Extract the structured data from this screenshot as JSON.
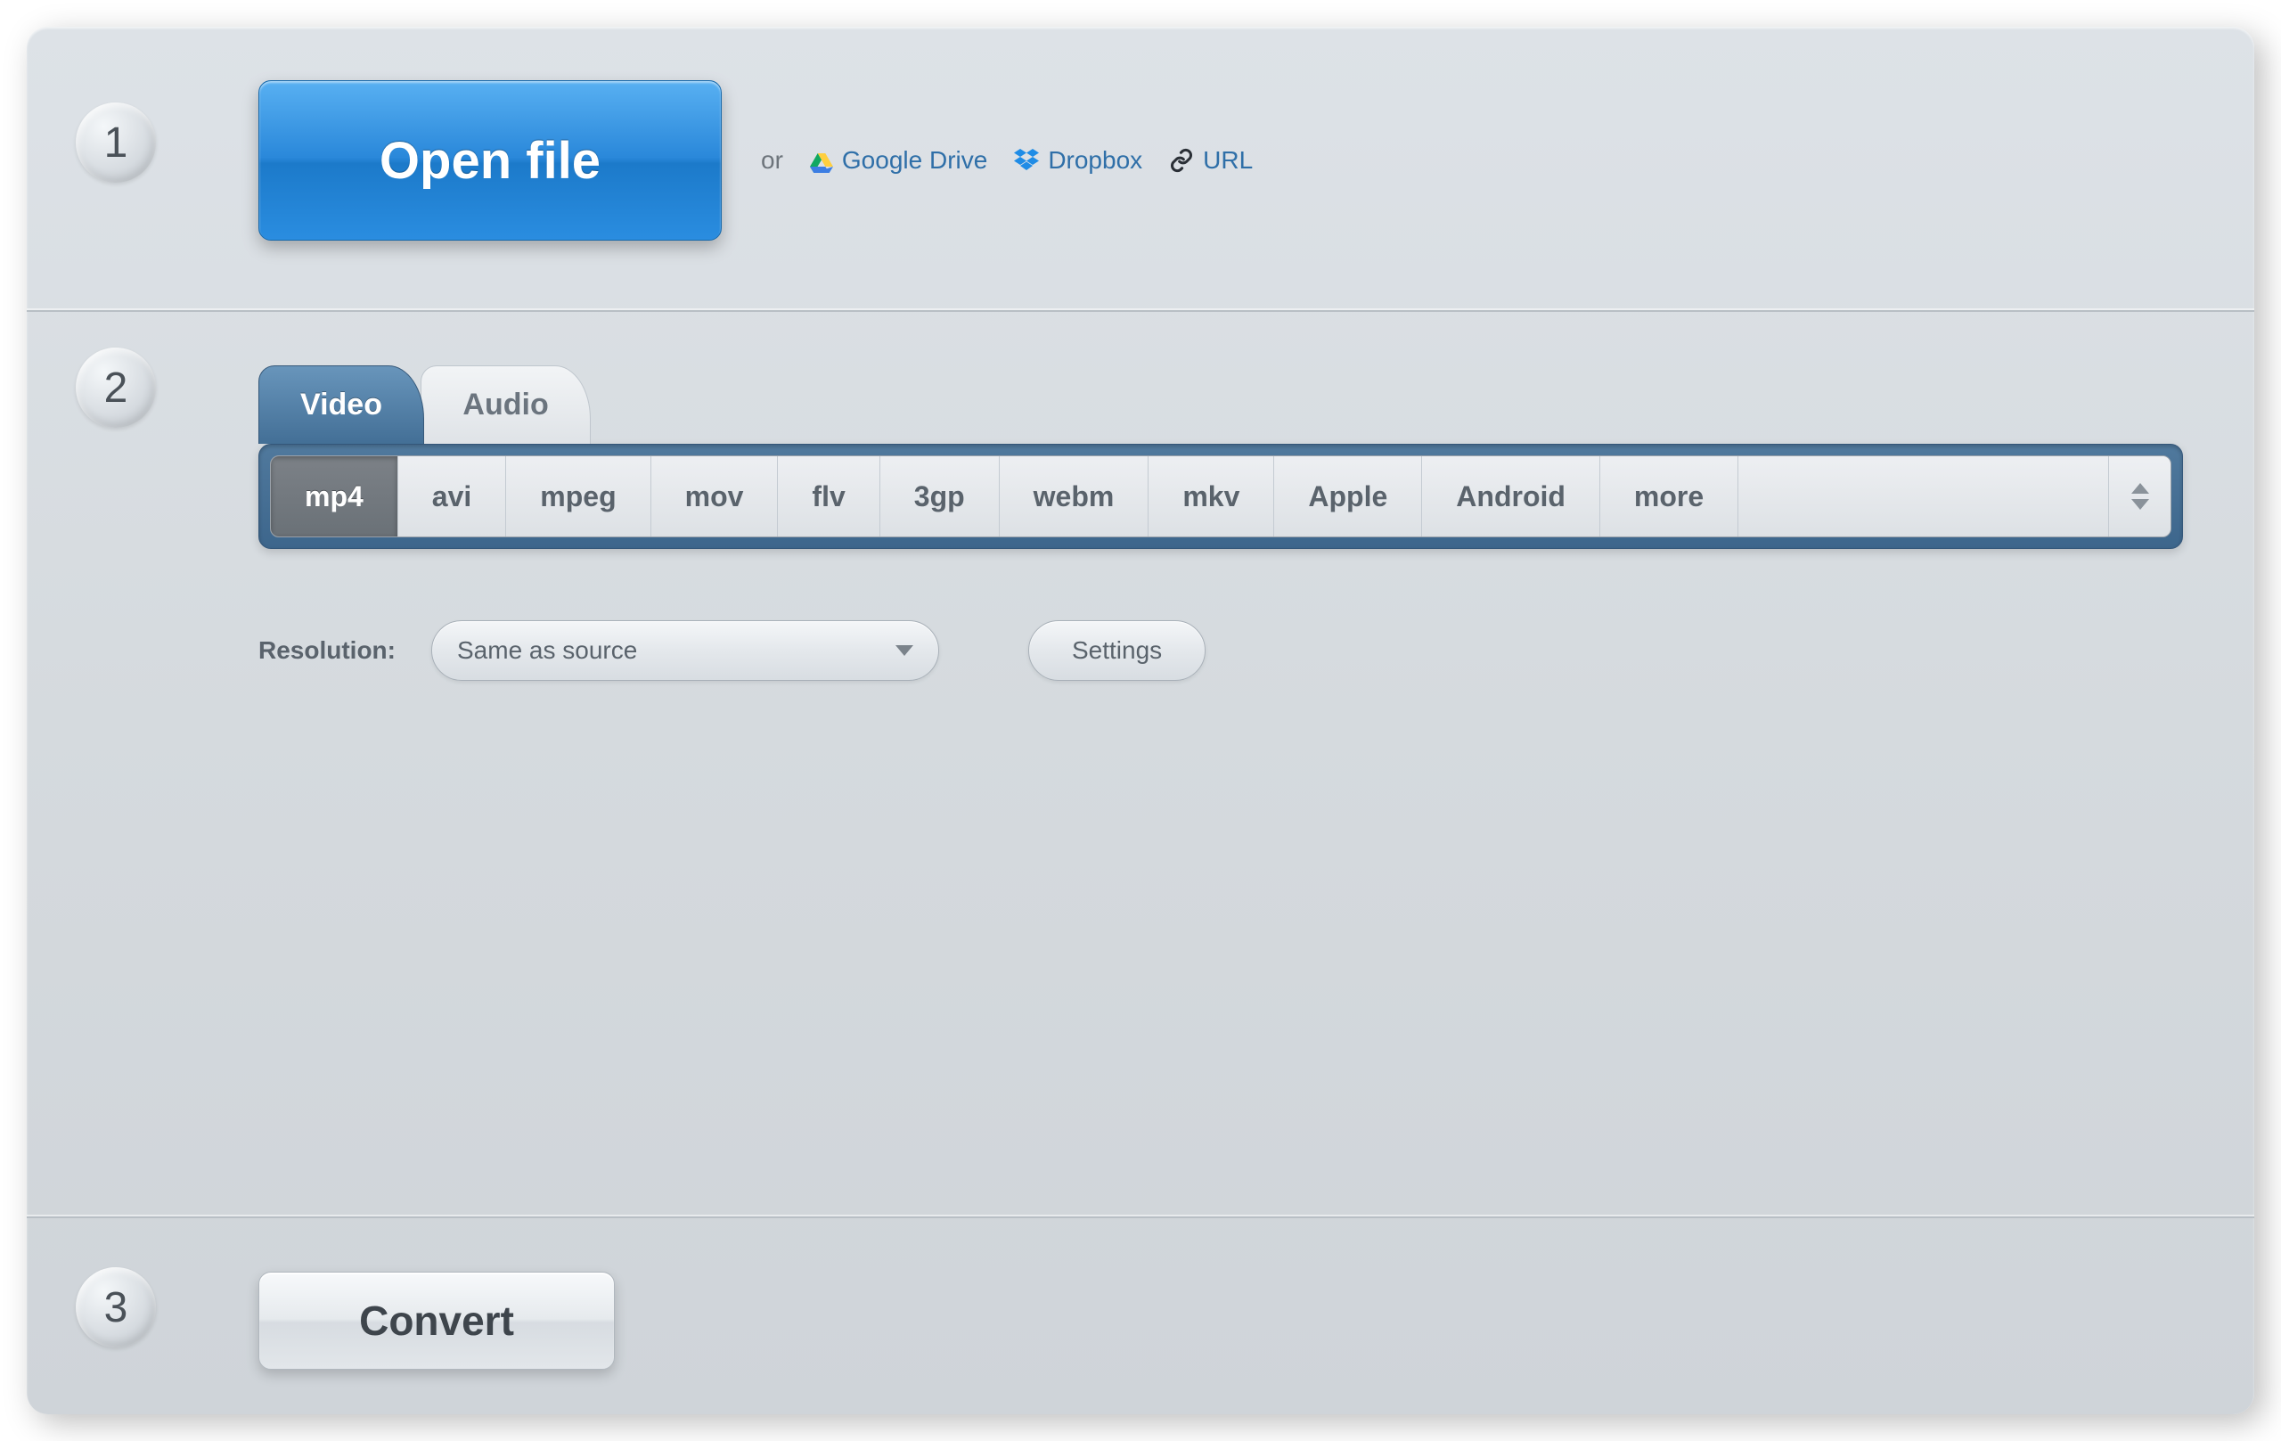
{
  "steps": {
    "one": "1",
    "two": "2",
    "three": "3"
  },
  "open": {
    "button_label": "Open file",
    "or_label": "or",
    "sources": {
      "gdrive": "Google Drive",
      "dropbox": "Dropbox",
      "url": "URL"
    }
  },
  "tabs": {
    "video": "Video",
    "audio": "Audio",
    "active": "video"
  },
  "formats": [
    "mp4",
    "avi",
    "mpeg",
    "mov",
    "flv",
    "3gp",
    "webm",
    "mkv",
    "Apple",
    "Android",
    "more"
  ],
  "formats_selected": "mp4",
  "resolution": {
    "label": "Resolution:",
    "value": "Same as source"
  },
  "settings_label": "Settings",
  "convert_label": "Convert"
}
